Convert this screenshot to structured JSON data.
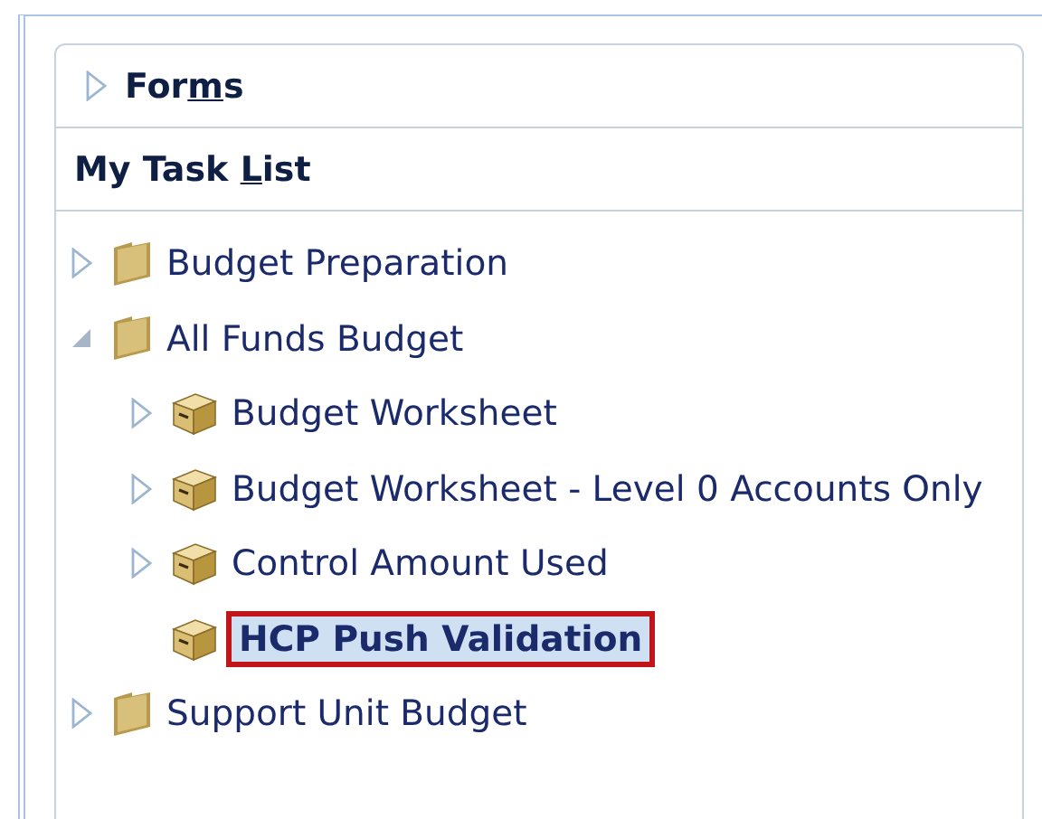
{
  "forms_header": {
    "title": {
      "before": "For",
      "key": "m",
      "after": "s"
    },
    "expanded": false
  },
  "task_list_header": {
    "title": {
      "before": "My Task ",
      "key": "L",
      "after": "ist"
    }
  },
  "tree": [
    {
      "kind": "folder",
      "label": "Budget Preparation",
      "expanded": false,
      "selected": false
    },
    {
      "kind": "folder",
      "label": "All Funds Budget",
      "expanded": true,
      "selected": false,
      "children": [
        {
          "kind": "task",
          "label": "Budget Worksheet",
          "expanded": false,
          "selected": false
        },
        {
          "kind": "task",
          "label": "Budget Worksheet - Level 0 Accounts Only",
          "expanded": false,
          "selected": false
        },
        {
          "kind": "task",
          "label": "Control Amount Used",
          "expanded": false,
          "selected": false
        },
        {
          "kind": "task",
          "label": "HCP Push Validation",
          "selected": true
        }
      ]
    },
    {
      "kind": "folder",
      "label": "Support Unit Budget",
      "expanded": false,
      "selected": false
    }
  ]
}
